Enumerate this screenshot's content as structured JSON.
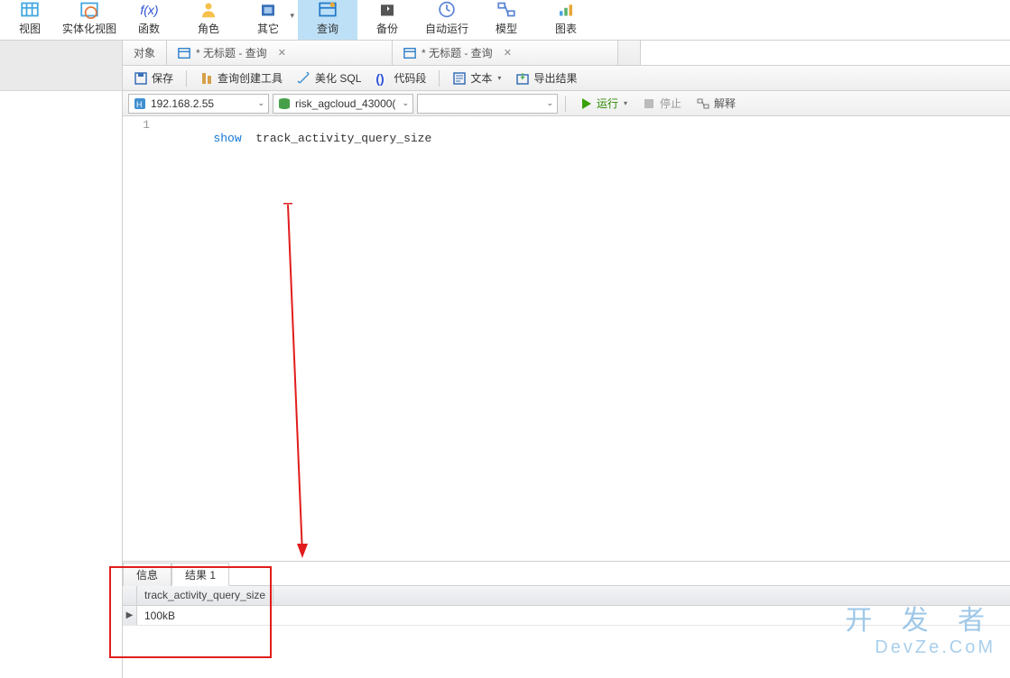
{
  "ribbon": {
    "items": [
      {
        "label": "视图"
      },
      {
        "label": "实体化视图"
      },
      {
        "label": "函数"
      },
      {
        "label": "角色"
      },
      {
        "label": "其它"
      },
      {
        "label": "查询"
      },
      {
        "label": "备份"
      },
      {
        "label": "自动运行"
      },
      {
        "label": "模型"
      },
      {
        "label": "图表"
      }
    ],
    "active_index": 5
  },
  "tabs": {
    "items": [
      {
        "label": "对象",
        "has_close": false,
        "has_icon": false
      },
      {
        "label": "* 无标题 - 查询",
        "has_close": true,
        "has_icon": true
      },
      {
        "label": "* 无标题 - 查询",
        "has_close": true,
        "has_icon": true
      }
    ]
  },
  "toolbar1": {
    "save": "保存",
    "query_builder": "查询创建工具",
    "beautify_sql": "美化 SQL",
    "code_snippet": "代码段",
    "text": "文本",
    "export_result": "导出结果"
  },
  "toolbar2": {
    "connection": "192.168.2.55",
    "database": "risk_agcloud_43000(",
    "schema": "",
    "run": "运行",
    "stop": "停止",
    "explain": "解释"
  },
  "editor": {
    "line_number": "1",
    "keyword": "show",
    "identifier": "track_activity_query_size"
  },
  "results": {
    "tab_info": "信息",
    "tab_result": "结果 1",
    "column_header": "track_activity_query_size",
    "cell_value": "100kB"
  },
  "watermark": {
    "line1": "开 发 者",
    "line2": "DevZe.CoM"
  }
}
